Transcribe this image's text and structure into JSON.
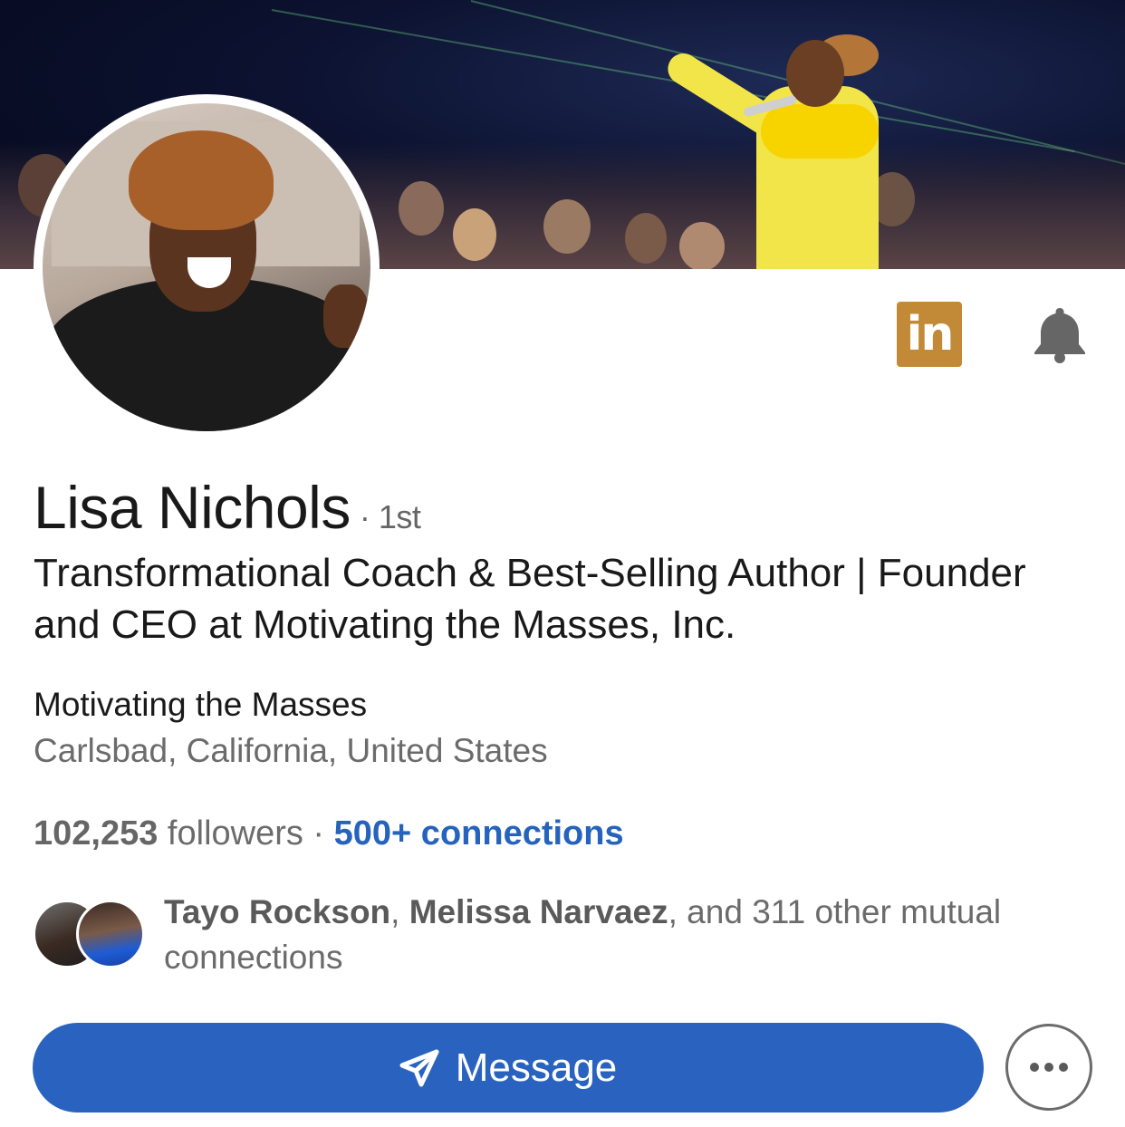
{
  "profile": {
    "name": "Lisa Nichols",
    "degree": "· 1st",
    "headline": "Transformational Coach & Best-Selling Author | Founder and CEO at Motivating the Masses, Inc.",
    "company": "Motivating the Masses",
    "location": "Carlsbad, California, United States",
    "followers_count": "102,253",
    "followers_label": " followers · ",
    "connections": "500+ connections"
  },
  "header_icons": {
    "linkedin_label": "in",
    "linkedin_color": "#c28a36",
    "bell_icon": "bell-icon"
  },
  "mutual": {
    "name1": "Tayo Rockson",
    "sep": ", ",
    "name2": "Melissa Narvaez",
    "rest": ", and 311 other mutual connections"
  },
  "actions": {
    "message_label": "Message",
    "message_color": "#2a63bf",
    "more_icon": "more-horizontal-icon"
  }
}
